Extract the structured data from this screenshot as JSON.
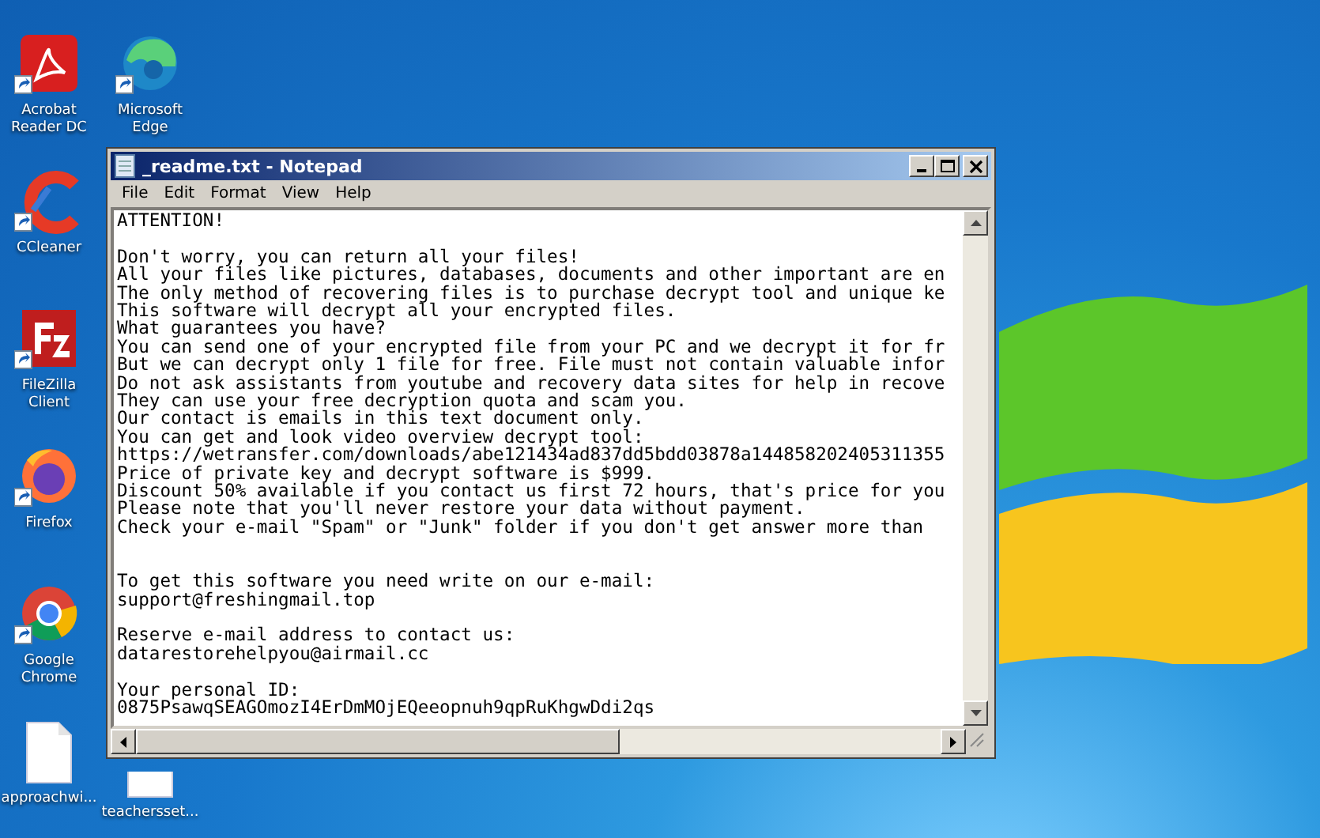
{
  "desktop": {
    "icons": [
      {
        "label": "Acrobat Reader DC",
        "kind": "acrobat"
      },
      {
        "label": "Microsoft Edge",
        "kind": "edge"
      },
      {
        "label": "CCleaner",
        "kind": "ccleaner"
      },
      {
        "label": "FileZilla Client",
        "kind": "filezilla"
      },
      {
        "label": "Firefox",
        "kind": "firefox"
      },
      {
        "label": "Google Chrome",
        "kind": "chrome"
      },
      {
        "label": "approachwi...",
        "kind": "file"
      },
      {
        "label": "teachersset...",
        "kind": "file"
      }
    ]
  },
  "window": {
    "title": "_readme.txt - Notepad",
    "menu": [
      "File",
      "Edit",
      "Format",
      "View",
      "Help"
    ],
    "paragraphs": [
      {
        "kind": "top",
        "lines": [
          "ATTENTION!"
        ]
      },
      {
        "kind": "gap",
        "lines": [
          "Don't worry, you can return all your files!",
          "All your files like pictures, databases, documents and other important are en",
          "The only method of recovering files is to purchase decrypt tool and unique ke",
          "This software will decrypt all your encrypted files.",
          "What guarantees you have?",
          "You can send one of your encrypted file from your PC and we decrypt it for fr",
          "But we can decrypt only 1 file for free. File must not contain valuable infor",
          "Do not ask assistants from youtube and recovery data sites for help in recove",
          "They can use your free decryption quota and scam you.",
          "Our contact is emails in this text document only.",
          "You can get and look video overview decrypt tool:",
          "https://wetransfer.com/downloads/abe121434ad837dd5bdd03878a144858202405311355",
          "Price of private key and decrypt software is $999.",
          "Discount 50% available if you contact us first 72 hours, that's price for you",
          "Please note that you'll never restore your data without payment.",
          "Check your e-mail \"Spam\" or \"Junk\" folder if you don't get answer more than"
        ]
      },
      {
        "kind": "double-gap",
        "lines": [
          "To get this software you need write on our e-mail:",
          "support@freshingmail.top"
        ]
      },
      {
        "kind": "gap",
        "lines": [
          "Reserve e-mail address to contact us:",
          "datarestorehelpyou@airmail.cc"
        ]
      },
      {
        "kind": "gap",
        "lines": [
          "Your personal ID:",
          "0875PsawqSEAGOmozI4ErDmMOjEQeeopnuh9qpRuKhgwDdi2qs"
        ]
      }
    ]
  }
}
